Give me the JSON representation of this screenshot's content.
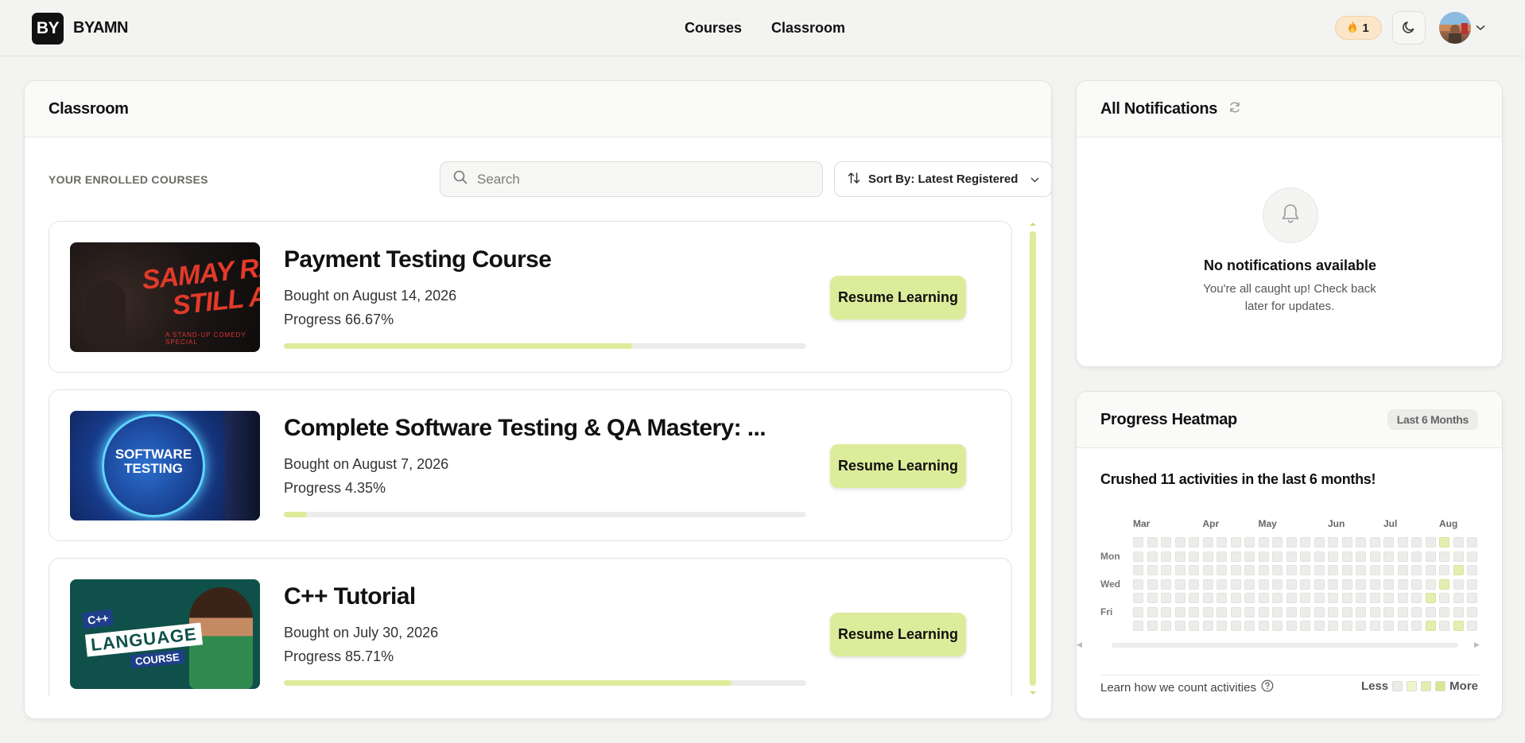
{
  "header": {
    "logo_mark": "BY",
    "logo_text": "BYAMN",
    "nav": [
      {
        "label": "Courses"
      },
      {
        "label": "Classroom"
      }
    ],
    "streak_count": "1"
  },
  "classroom": {
    "title": "Classroom",
    "section_label": "YOUR ENROLLED COURSES",
    "search_placeholder": "Search",
    "sort_label": "Sort By: Latest Registered",
    "courses": [
      {
        "title": "Payment Testing Course",
        "bought": "Bought on August 14, 2026",
        "progress_text": "Progress 66.67%",
        "progress": 66.67,
        "button": "Resume Learning",
        "thumb_text": "SAMAY RAINA\nSTILL ALIVE",
        "thumb_sub": "A STAND-UP COMEDY SPECIAL"
      },
      {
        "title": "Complete Software Testing & QA Mastery: ...",
        "bought": "Bought on August 7, 2026",
        "progress_text": "Progress 4.35%",
        "progress": 4.35,
        "button": "Resume Learning",
        "thumb_text": "SOFTWARE\nTESTING"
      },
      {
        "title": "C++ Tutorial",
        "bought": "Bought on July 30, 2026",
        "progress_text": "Progress 85.71%",
        "progress": 85.71,
        "button": "Resume Learning",
        "thumb_cpp": "C++",
        "thumb_lang": "LANGUAGE",
        "thumb_course": "COURSE"
      }
    ]
  },
  "notifications": {
    "title": "All Notifications",
    "empty_title": "No notifications available",
    "empty_text": "You're all caught up! Check back later for updates."
  },
  "heatmap": {
    "title": "Progress Heatmap",
    "range_badge": "Last 6 Months",
    "summary": "Crushed 11 activities in the last 6 months!",
    "months": [
      "Mar",
      "Apr",
      "May",
      "Jun",
      "Jul",
      "Aug"
    ],
    "days": [
      "Mon",
      "Wed",
      "Fri"
    ],
    "weeks": 25,
    "active_cells": [
      [
        22,
        0
      ],
      [
        23,
        2
      ],
      [
        22,
        3
      ],
      [
        21,
        4
      ],
      [
        23,
        6
      ],
      [
        21,
        6
      ]
    ],
    "learn_text": "Learn how we count activities",
    "legend_less": "Less",
    "legend_more": "More",
    "legend_colors": [
      "#ececea",
      "#eef5c9",
      "#e2efb0",
      "#d6e88f"
    ]
  },
  "colors": {
    "accent": "#dcec9a",
    "streak_bg": "#fbe6c9"
  }
}
